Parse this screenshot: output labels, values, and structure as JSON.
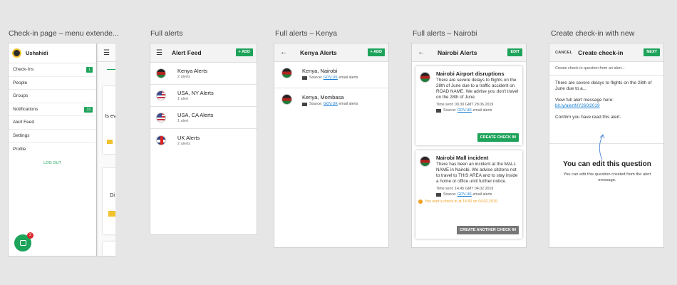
{
  "captions": [
    "Check-in page – menu extende...",
    "Full alerts",
    "Full alerts – Kenya",
    "Full alerts – Nairobi",
    "Create check-in with new"
  ],
  "screen1": {
    "app_name": "Ushahidi",
    "menu": [
      {
        "label": "Check-Ins",
        "count": "1"
      },
      {
        "label": "People"
      },
      {
        "label": "Groups"
      },
      {
        "label": "Notifications",
        "count": "33"
      },
      {
        "label": "Alert Feed"
      },
      {
        "label": "Settings"
      },
      {
        "label": "Profile"
      }
    ],
    "logout": "LOG OUT",
    "bg_text_1": "Is ev",
    "bg_text_2": "Di",
    "chat_badge": "2"
  },
  "screen2": {
    "title": "Alert Feed",
    "add": "+ ADD",
    "items": [
      {
        "name": "Kenya Alerts",
        "sub": "2 alerts",
        "flag": "kenya-flag-icon"
      },
      {
        "name": "USA, NY Alerts",
        "sub": "1 alert",
        "flag": "usa-flag-icon"
      },
      {
        "name": "USA, CA Alerts",
        "sub": "1 alert",
        "flag": "usa-flag-icon"
      },
      {
        "name": "UK Alerts",
        "sub": "2 alerts",
        "flag": "uk-flag-icon"
      }
    ]
  },
  "screen3": {
    "title": "Kenya Alerts",
    "add": "+ ADD",
    "items": [
      {
        "name": "Kenya, Nairobi",
        "src_prefix": "Source:",
        "src_link": "GOV.UK",
        "src_suffix": "email alerts"
      },
      {
        "name": "Kenya, Mombasa",
        "src_prefix": "Source:",
        "src_link": "GOV.UK",
        "src_suffix": "email alerts"
      }
    ]
  },
  "screen4": {
    "title": "Nairobi Alerts",
    "edit": "EDIT",
    "cards": [
      {
        "title": "Nairobi Airport disruptions",
        "body": "There are severe delays to flights on the 28th of June due to a traffic accident on ROAD NAME. We advise you don't travel on the 28th of June.",
        "time": "Time sent: 09.30 GMT 28.06.2019",
        "src_prefix": "Source:",
        "src_link": "GOV.UK",
        "src_suffix": "email alerts",
        "button": "CREATE CHECK IN"
      },
      {
        "title": "Nairobi Mall incident",
        "body": "There has been an incident at the MALL NAME in Nairobi. We advise citizens not to travel to THIS AREA and to stay inside a home or office until further notice.",
        "time": "Time sent: 14.45 GMT 04.02.2019",
        "src_prefix": "Source:",
        "src_link": "GOV.UK",
        "src_suffix": "email alerts",
        "warning": "You sent a check in at 14.50 on 04.02.2019",
        "button": "CREATE ANOTHER CHECK IN"
      }
    ]
  },
  "screen5": {
    "cancel": "CANCEL",
    "title": "Create check-in",
    "next": "NEXT",
    "hint": "Create check-in question from an alert...",
    "p1": "There are severe delays to flights on the 28th of June due to a...",
    "p2": "View full alert message here:",
    "link": "bit.ly/alertNY260l2019",
    "p3": "Confirm you have read this alert.",
    "heading": "You can edit this question",
    "sub": "You can edit this question created from the alert message."
  },
  "colors": {
    "accent": "#1ea35a",
    "link": "#1b7fd4",
    "warning": "#f0a020"
  }
}
